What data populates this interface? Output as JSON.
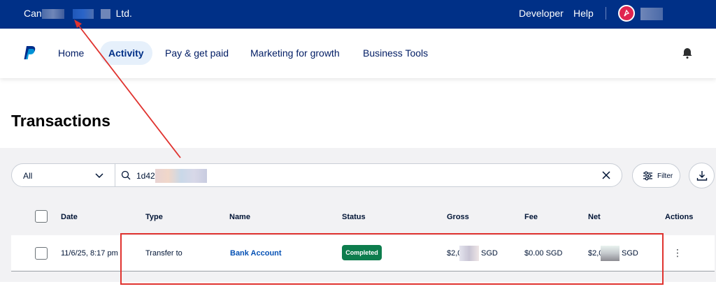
{
  "topbar": {
    "business_prefix": "Can",
    "business_suffix": "Ltd.",
    "developer": "Developer",
    "help": "Help"
  },
  "nav": {
    "items": [
      {
        "label": "Home"
      },
      {
        "label": "Activity",
        "active": true
      },
      {
        "label": "Pay & get paid"
      },
      {
        "label": "Marketing for growth"
      },
      {
        "label": "Business Tools"
      }
    ]
  },
  "page": {
    "title": "Transactions"
  },
  "filters": {
    "type_selected": "All",
    "search_value": "1d42e",
    "filter_label": "Filter"
  },
  "table": {
    "headers": [
      "Date",
      "Type",
      "Name",
      "Status",
      "Gross",
      "Fee",
      "Net",
      "Actions"
    ],
    "rows": [
      {
        "date": "11/6/25, 8:17 pm",
        "type": "Transfer to",
        "name": "Bank Account",
        "status": "Completed",
        "gross_prefix": "$2,0",
        "gross_suffix": "SGD",
        "fee": "$0.00 SGD",
        "net_prefix": "$2,0",
        "net_suffix": "SGD"
      }
    ]
  },
  "colors": {
    "brand_navy": "#003087",
    "status_green": "#0d7d4d",
    "link_blue": "#0551b5",
    "annotation_red": "#e0332f"
  },
  "icons": [
    "paypal-logo-icon",
    "bell-icon",
    "chevron-down-icon",
    "search-icon",
    "close-icon",
    "filter-sliders-icon",
    "download-icon",
    "kebab-menu-icon",
    "avatar-icon"
  ]
}
